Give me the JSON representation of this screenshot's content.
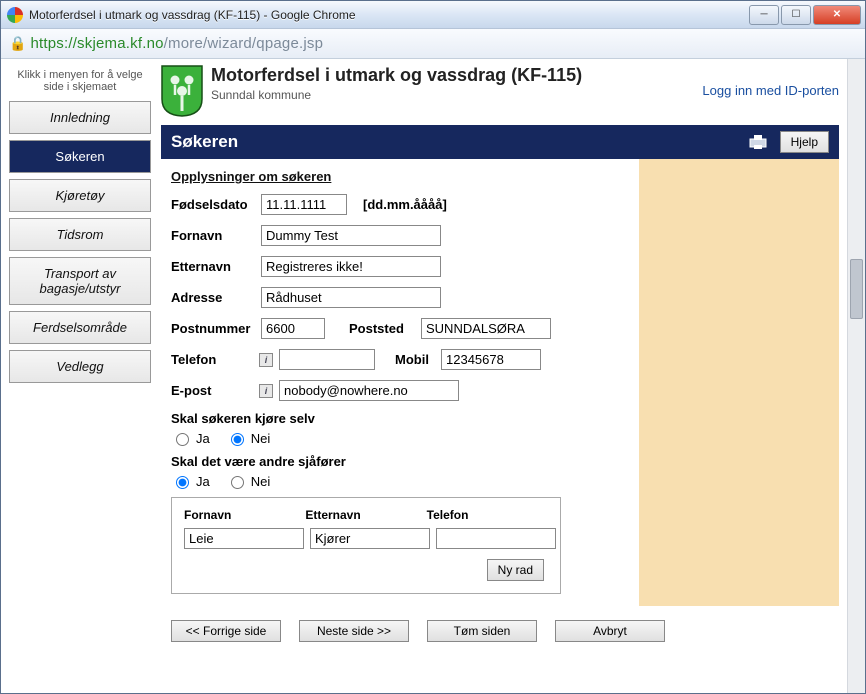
{
  "browser": {
    "title": "Motorferdsel i utmark og vassdrag (KF-115) - Google Chrome",
    "url_host": "https://skjema.kf.no",
    "url_path": "/more/wizard/qpage.jsp"
  },
  "menu": {
    "hint": "Klikk i menyen for å velge side i skjemaet",
    "items": [
      "Innledning",
      "Søkeren",
      "Kjøretøy",
      "Tidsrom",
      "Transport av bagasje/utstyr",
      "Ferdselsområde",
      "Vedlegg"
    ],
    "active_index": 1
  },
  "header": {
    "title": "Motorferdsel i utmark og vassdrag (KF-115)",
    "subtitle": "Sunndal kommune",
    "login": "Logg inn med ID-porten"
  },
  "section": {
    "title": "Søkeren",
    "help": "Hjelp"
  },
  "form": {
    "section_heading": "Opplysninger om søkeren",
    "labels": {
      "fodselsdato": "Fødselsdato",
      "fornavn": "Fornavn",
      "etternavn": "Etternavn",
      "adresse": "Adresse",
      "postnummer": "Postnummer",
      "poststed": "Poststed",
      "telefon": "Telefon",
      "mobil": "Mobil",
      "epost": "E-post"
    },
    "values": {
      "fodselsdato": "11.11.1111",
      "fornavn": "Dummy Test",
      "etternavn": "Registreres ikke!",
      "adresse": "Rådhuset",
      "postnummer": "6600",
      "poststed": "SUNNDALSØRA",
      "telefon": "",
      "mobil": "12345678",
      "epost": "nobody@nowhere.no"
    },
    "date_hint": "[dd.mm.åååå]",
    "q1": "Skal søkeren kjøre selv",
    "q2": "Skal det være andre sjåfører",
    "ja": "Ja",
    "nei": "Nei",
    "driver_headers": {
      "fornavn": "Fornavn",
      "etternavn": "Etternavn",
      "telefon": "Telefon"
    },
    "driver_values": {
      "fornavn": "Leie",
      "etternavn": "Kjører",
      "telefon": ""
    },
    "ny_rad": "Ny rad"
  },
  "nav": {
    "prev": "<< Forrige side",
    "next": "Neste side >>",
    "clear": "Tøm siden",
    "cancel": "Avbryt"
  }
}
